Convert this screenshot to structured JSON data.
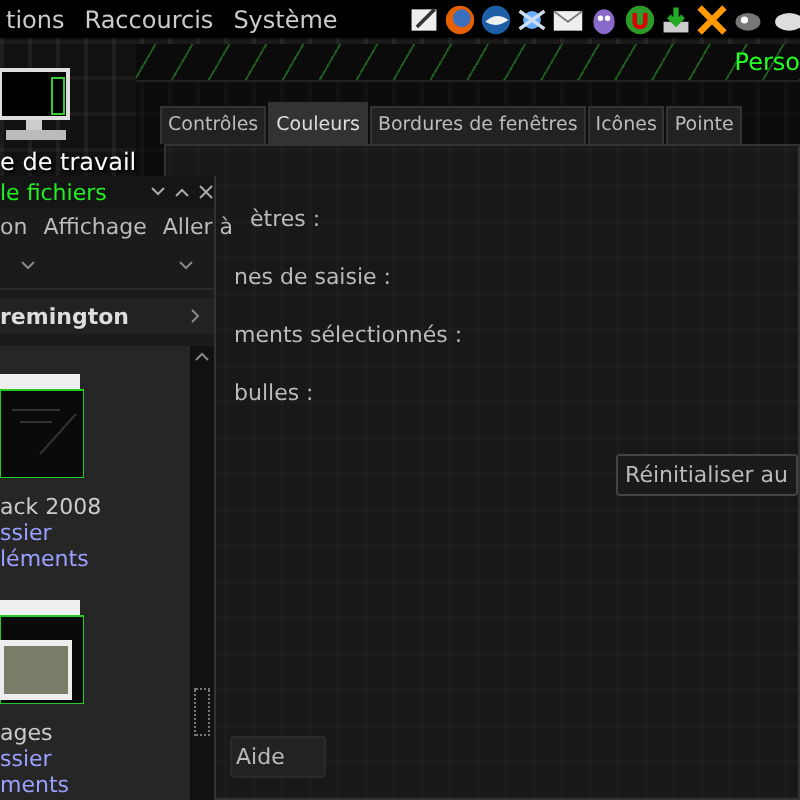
{
  "top_panel": {
    "menus": [
      "tions",
      "Raccourcis",
      "Système"
    ]
  },
  "desktop_icons": [
    {
      "label": "e de travail"
    }
  ],
  "appearance_window": {
    "title": "Perso",
    "tabs": [
      {
        "label": "Contrôles",
        "selected": false
      },
      {
        "label": "Couleurs",
        "selected": true
      },
      {
        "label": "Bordures de fenêtres",
        "selected": false
      },
      {
        "label": "Icônes",
        "selected": false
      },
      {
        "label": "Pointe",
        "selected": false
      }
    ],
    "labels": [
      "ètres :",
      "nes de saisie :",
      "ments sélectionnés :",
      "bulles :"
    ],
    "reset_button": "Réinitialiser au",
    "help_button": "Aide"
  },
  "file_manager": {
    "title": "le fichiers",
    "menus": [
      "on",
      "Affichage",
      "Aller à"
    ],
    "location": "remington",
    "items": [
      {
        "kind": "folder",
        "name": "ack 2008",
        "type": "ssier",
        "detail": "léments"
      },
      {
        "kind": "images",
        "name": "ages",
        "type": "ssier",
        "detail": "ments"
      }
    ]
  }
}
